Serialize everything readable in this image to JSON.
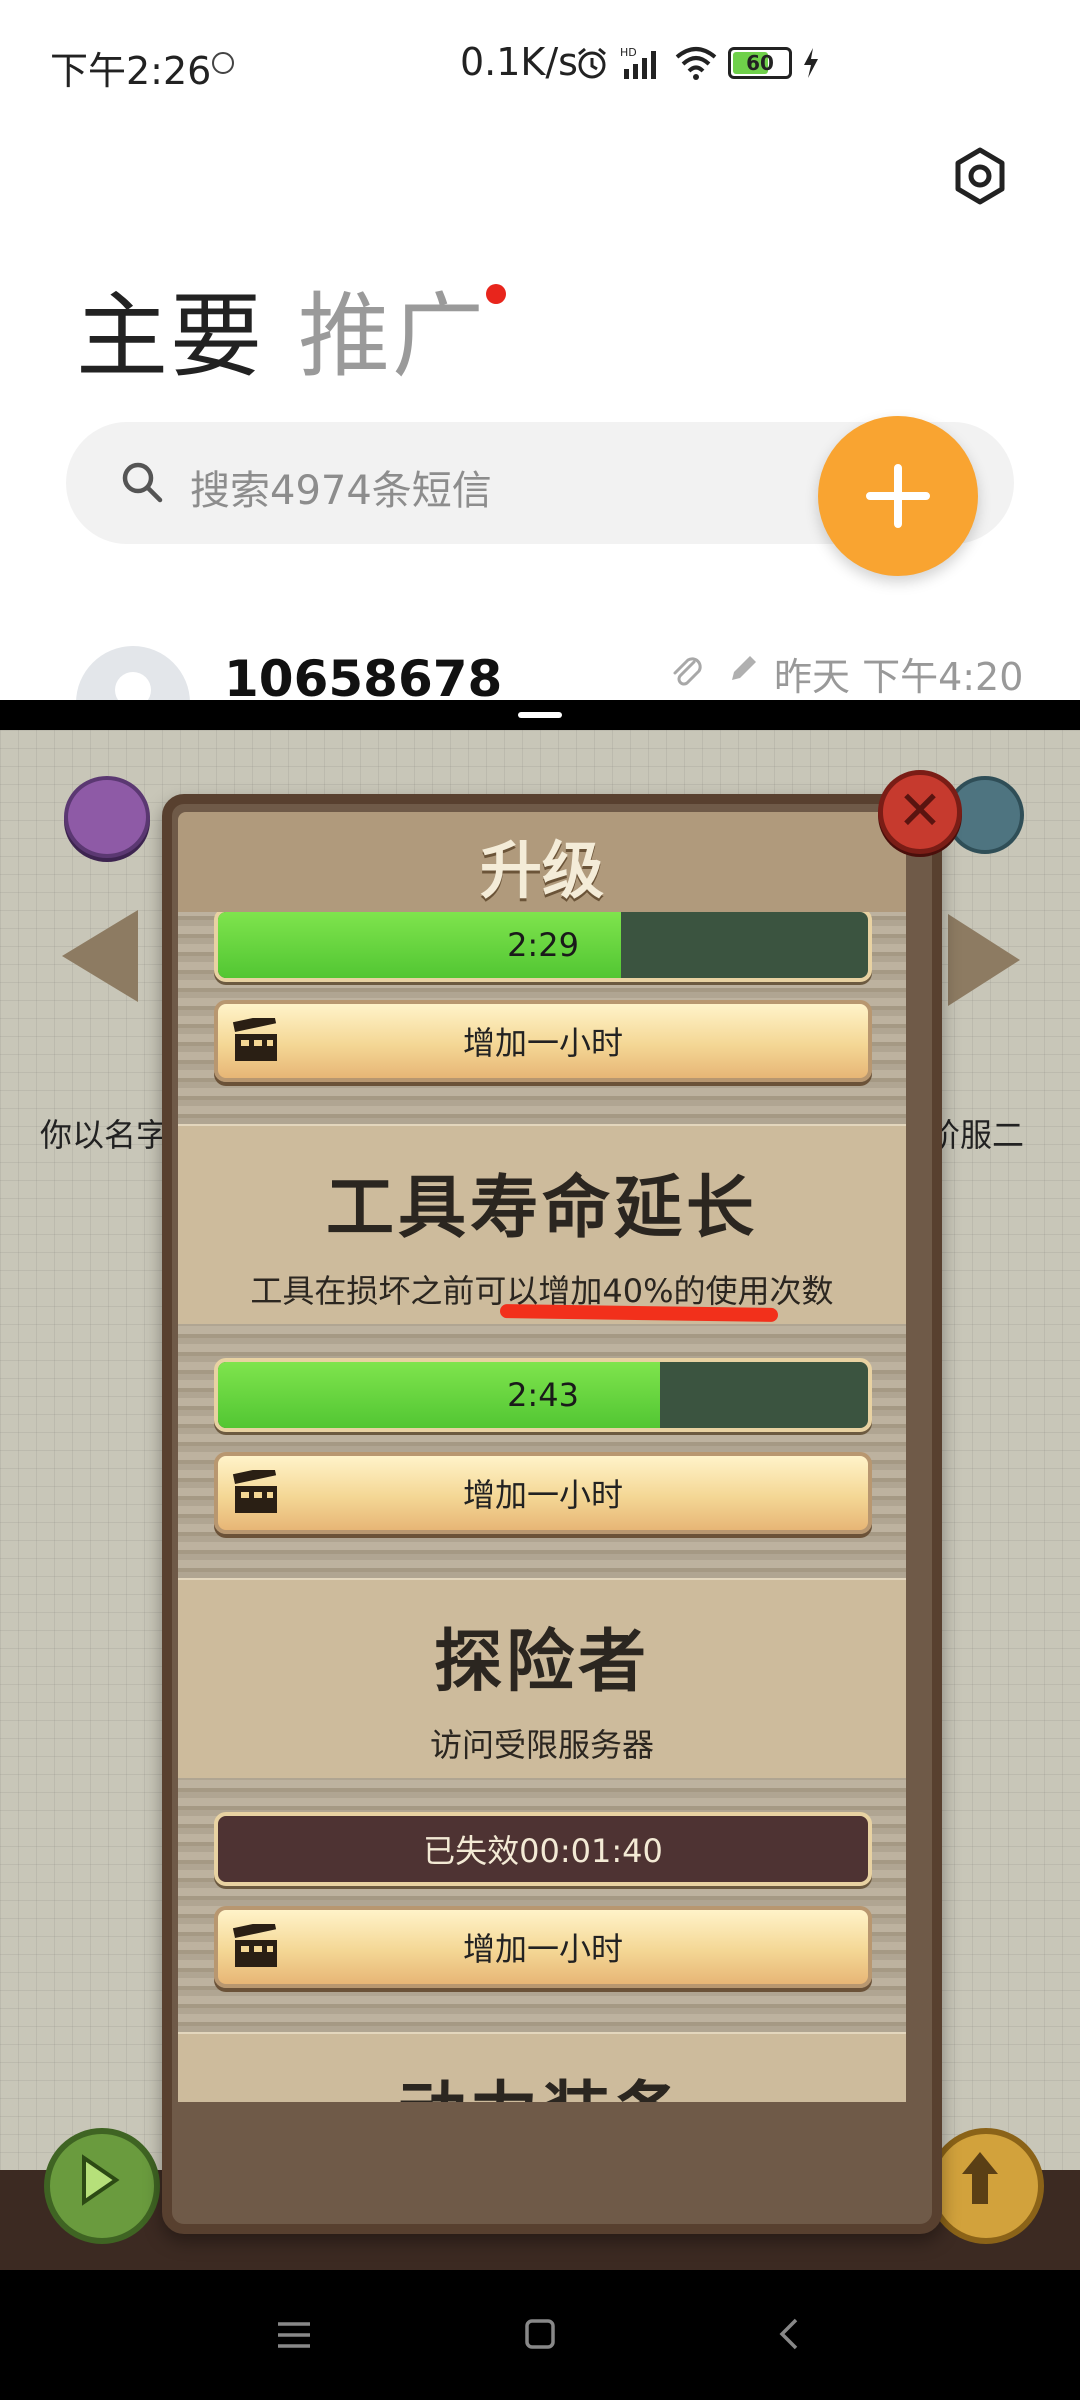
{
  "status_bar": {
    "time": "下午2:26",
    "network_speed": "0.1K/s",
    "battery": "60"
  },
  "sms_app": {
    "tabs": [
      {
        "label": "主要"
      },
      {
        "label": "推广"
      }
    ],
    "search_placeholder": "搜索4974条短信",
    "message": {
      "sender": "10658678",
      "time": "昨天 下午4:20"
    }
  },
  "game": {
    "left_caption": "你以名字",
    "right_caption": "阶服二",
    "dialog": {
      "title": "升级",
      "items": [
        {
          "bar_label": "2:29",
          "progress": 0.62,
          "button_label": "增加一小时"
        },
        {
          "title": "工具寿命延长",
          "description": "工具在损坏之前可以增加40%的使用次数",
          "bar_label": "2:43",
          "progress": 0.68,
          "button_label": "增加一小时"
        },
        {
          "title": "探险者",
          "description": "访问受限服务器",
          "bar_label": "已失效00:01:40",
          "progress": 0,
          "status": "expired",
          "button_label": "增加一小时"
        },
        {
          "title": "动力装备"
        }
      ]
    }
  },
  "colors": {
    "fab": "#f9a431",
    "progress_fill": "#52c633",
    "annotation_underline": "#f2301b",
    "promo_dot": "#e8251c"
  }
}
